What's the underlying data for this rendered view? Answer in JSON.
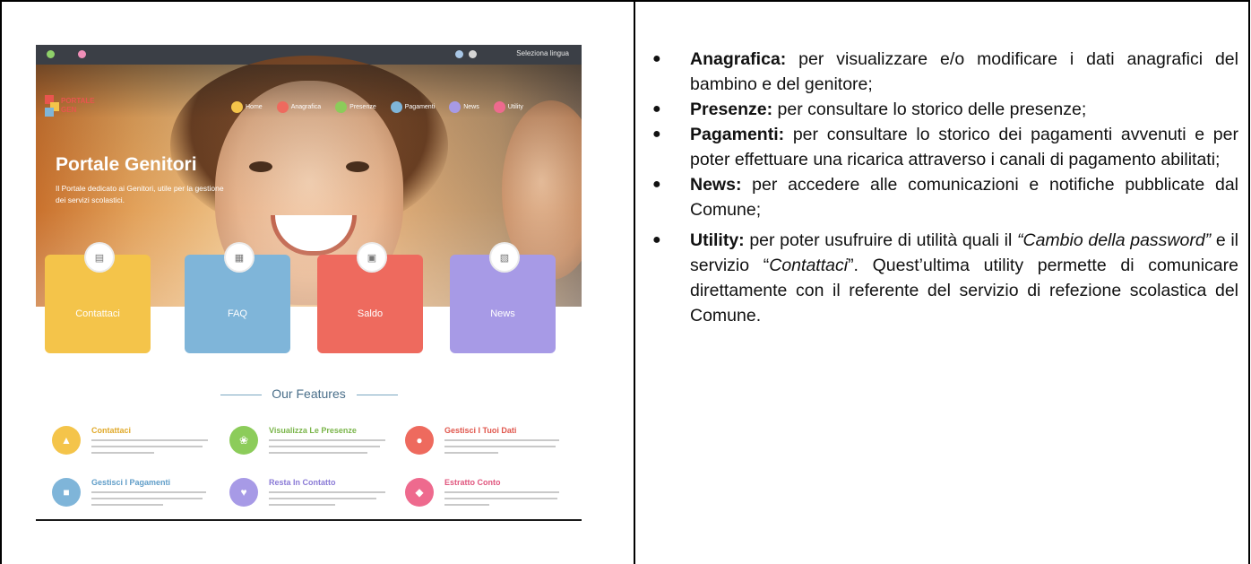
{
  "screenshot": {
    "language_selector": "Seleziona lingua",
    "logo_text": [
      "PORTALE",
      "GEN"
    ],
    "nav": [
      "Home",
      "Anagrafica",
      "Presenze",
      "Pagamenti",
      "News",
      "Utility"
    ],
    "hero_title": "Portale Genitori",
    "hero_subtitle": "Il Portale dedicato ai Genitori, utile per la gestione dei servizi scolastici.",
    "cards": [
      {
        "label": "Contattaci",
        "color": "#f4c44a",
        "icon": "document-icon"
      },
      {
        "label": "FAQ",
        "color": "#7fb5d9",
        "icon": "calendar-icon"
      },
      {
        "label": "Saldo",
        "color": "#ee6a5e",
        "icon": "image-icon"
      },
      {
        "label": "News",
        "color": "#a79ae6",
        "icon": "tag-icon"
      }
    ],
    "features_title": "Our Features",
    "features": [
      {
        "title": "Contattaci",
        "color": "#f4c44a",
        "icon": "graduation-icon"
      },
      {
        "title": "Visualizza Le Presenze",
        "color": "#8ccc5a",
        "icon": "leaf-icon"
      },
      {
        "title": "Gestisci I Tuoi Dati",
        "color": "#ee6a5e",
        "icon": "car-icon"
      },
      {
        "title": "Gestisci I Pagamenti",
        "color": "#7fb5d9",
        "icon": "building-icon"
      },
      {
        "title": "Resta In Contatto",
        "color": "#a79ae6",
        "icon": "heart-icon"
      },
      {
        "title": "Estratto Conto",
        "color": "#ee6a8e",
        "icon": "shield-icon"
      }
    ]
  },
  "bullets": [
    {
      "term": "Anagrafica:",
      "text": " per visualizzare e/o modificare i dati anagrafici del bambino e del genitore;"
    },
    {
      "term": "Presenze:",
      "text": " per consultare lo storico delle presenze;"
    },
    {
      "term": "Pagamenti:",
      "text": " per consultare lo storico dei pagamenti avvenuti e per poter effettuare una ricarica attraverso i canali di pagamento abilitati;"
    },
    {
      "term": "News:",
      "text": " per accedere alle comunicazioni e notifiche pubblicate dal Comune;"
    },
    {
      "term": "Utility:",
      "text_1": " per poter usufruire di utilità quali il ",
      "italic_1": "“Cambio della password”",
      "text_2": " e il servizio “",
      "italic_2": "Contattaci",
      "text_3": "”. Quest’ultima utility permette di comunicare direttamente con il referente del servizio di refezione scolastica del Comune."
    }
  ]
}
